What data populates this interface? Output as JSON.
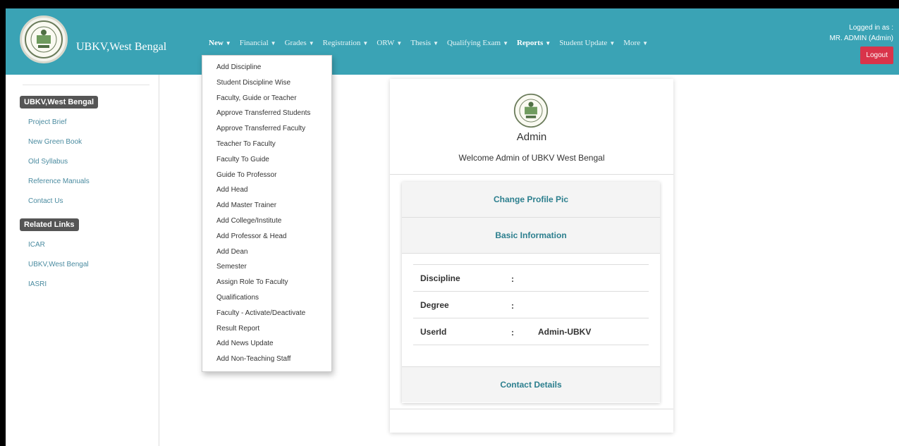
{
  "header": {
    "brand": "UBKV,West Bengal",
    "nav": [
      {
        "label": "New",
        "bold": true
      },
      {
        "label": "Financial",
        "bold": false
      },
      {
        "label": "Grades",
        "bold": false
      },
      {
        "label": "Registration",
        "bold": false
      },
      {
        "label": "ORW",
        "bold": false
      },
      {
        "label": "Thesis",
        "bold": false
      },
      {
        "label": "Qualifying Exam",
        "bold": false
      },
      {
        "label": "Reports",
        "bold": true
      },
      {
        "label": "Student Update",
        "bold": false
      },
      {
        "label": "More",
        "bold": false
      }
    ],
    "logged_in_label": "Logged in as :",
    "user": "MR. ADMIN (Admin)",
    "logout": "Logout"
  },
  "sidebar": {
    "heading1": "UBKV,West Bengal",
    "links1": [
      "Project Brief",
      "New Green Book",
      "Old Syllabus",
      "Reference Manuals",
      "Contact Us"
    ],
    "heading2": "Related Links",
    "links2": [
      "ICAR",
      "UBKV,West Bengal",
      "IASRI"
    ]
  },
  "dropdown": {
    "items": [
      "Add Discipline",
      "Student Discipline Wise",
      "Faculty, Guide or Teacher",
      "Approve Transferred Students",
      "Approve Transferred Faculty",
      "Teacher To Faculty",
      "Faculty To Guide",
      "Guide To Professor",
      "Add Head",
      "Add Master Trainer",
      "Add College/Institute",
      "Add Professor & Head",
      "Add Dean",
      "Semester",
      "Assign Role To Faculty",
      "Qualifications",
      "Faculty - Activate/Deactivate",
      "Result Report",
      "Add News Update",
      "Add Non-Teaching Staff"
    ]
  },
  "profile": {
    "name": "Admin",
    "welcome": "Welcome Admin of UBKV West Bengal",
    "change_pic": "Change Profile Pic",
    "basic_info": "Basic Information",
    "fields": [
      {
        "label": "Discipline",
        "colon": ":",
        "value": ""
      },
      {
        "label": "Degree",
        "colon": ":",
        "value": ""
      },
      {
        "label": "UserId",
        "colon": ":",
        "value": "Admin-UBKV"
      }
    ],
    "contact": "Contact Details"
  },
  "icons": {
    "logo": "university-seal-icon",
    "caret": "caret-down-icon"
  },
  "colors": {
    "header_bg": "#3aa3b5",
    "logout_bg": "#d9344a",
    "section_title": "#2c7f8e",
    "sidebar_link": "#4a8ba0"
  }
}
